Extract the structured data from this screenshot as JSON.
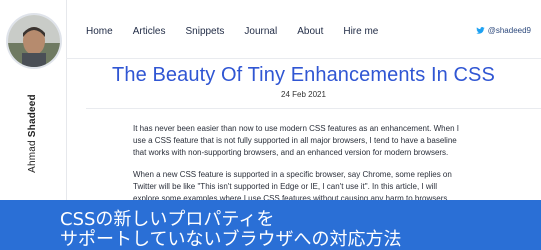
{
  "author": {
    "first_name": "Ahmad",
    "last_name": "Shadeed"
  },
  "nav": {
    "items": [
      "Home",
      "Articles",
      "Snippets",
      "Journal",
      "About",
      "Hire me"
    ],
    "twitter_handle": "@shadeed9"
  },
  "article": {
    "title": "The Beauty Of Tiny Enhancements In CSS",
    "date": "24 Feb 2021",
    "paragraphs": [
      "It has never been easier than now to use modern CSS features as an enhancement. When I use a CSS feature that is not fully supported in all major browsers, I tend to have a baseline that works with non-supporting browsers, and an enhanced version for modern browsers.",
      "When a new CSS feature is supported in a specific browser, say Chrome, some replies on Twitter will be like \"This isn't supported in Edge or IE, I can't use it\". In this article, I will explore some examples where I use CSS features without causing any harm to browsers"
    ]
  },
  "banner": {
    "line1": "CSSの新しいプロパティを",
    "line2": "サポートしていないブラウザへの対応方法"
  },
  "colors": {
    "title": "#3056d3",
    "banner_bg": "#2a6fd6",
    "twitter": "#1da1f2"
  }
}
